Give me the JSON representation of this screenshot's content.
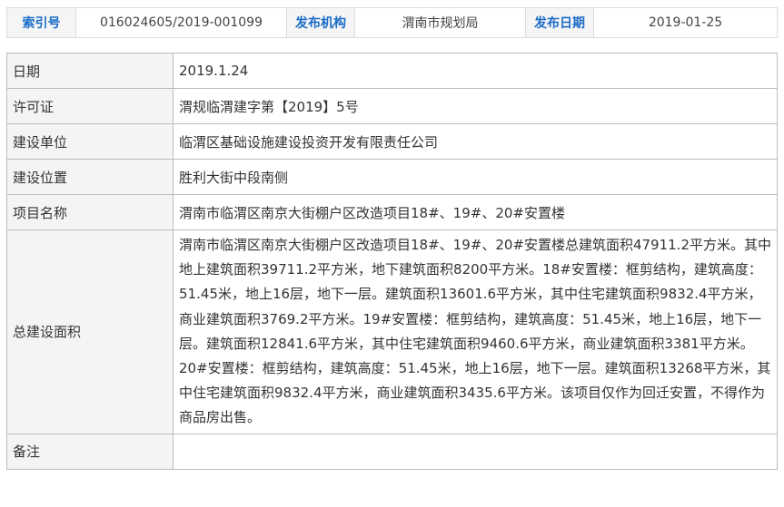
{
  "meta": {
    "index_label": "索引号",
    "index_value": "016024605/2019-001099",
    "publisher_label": "发布机构",
    "publisher_value": "渭南市规划局",
    "date_label": "发布日期",
    "date_value": "2019-01-25"
  },
  "details": [
    {
      "label": "日期",
      "value": "2019.1.24"
    },
    {
      "label": "许可证",
      "value": "渭规临渭建字第【2019】5号"
    },
    {
      "label": "建设单位",
      "value": "临渭区基础设施建设投资开发有限责任公司"
    },
    {
      "label": "建设位置",
      "value": "胜利大街中段南侧"
    },
    {
      "label": "项目名称",
      "value": "渭南市临渭区南京大街棚户区改造项目18#、19#、20#安置楼"
    },
    {
      "label": "总建设面积",
      "value": "渭南市临渭区南京大街棚户区改造项目18#、19#、20#安置楼总建筑面积47911.2平方米。其中地上建筑面积39711.2平方米，地下建筑面积8200平方米。18#安置楼：框剪结构，建筑高度：51.45米，地上16层，地下一层。建筑面积13601.6平方米，其中住宅建筑面积9832.4平方米，商业建筑面积3769.2平方米。19#安置楼：框剪结构，建筑高度：51.45米，地上16层，地下一层。建筑面积12841.6平方米，其中住宅建筑面积9460.6平方米，商业建筑面积3381平方米。20#安置楼：框剪结构，建筑高度：51.45米，地上16层，地下一层。建筑面积13268平方米，其中住宅建筑面积9832.4平方米，商业建筑面积3435.6平方米。该项目仅作为回迁安置，不得作为商品房出售。"
    },
    {
      "label": "备注",
      "value": ""
    }
  ],
  "colors": {
    "meta_key_text": "#1a6cc8",
    "label_bg": "#f4f4f4",
    "border": "#bcbcbc"
  }
}
